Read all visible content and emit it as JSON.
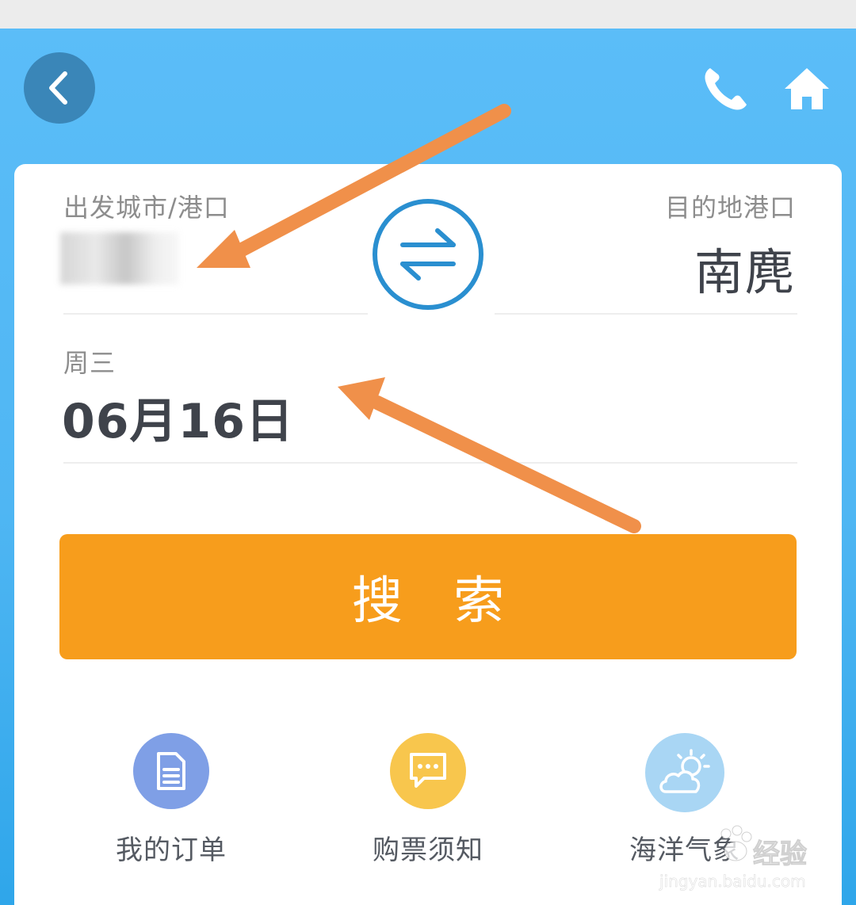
{
  "header": {
    "back_icon": "chevron-left-icon",
    "phone_icon": "phone-icon",
    "home_icon": "home-icon"
  },
  "route": {
    "from_label": "出发城市/港口",
    "from_value_obscured": true,
    "to_label": "目的地港口",
    "to_value": "南麂",
    "swap_icon": "swap-arrows-icon"
  },
  "date": {
    "weekday": "周三",
    "value": "06月16日"
  },
  "search": {
    "label": "搜 索"
  },
  "quick_links": [
    {
      "label": "我的订单",
      "icon": "document-icon"
    },
    {
      "label": "购票须知",
      "icon": "chat-bubble-icon"
    },
    {
      "label": "海洋气象",
      "icon": "weather-icon"
    }
  ],
  "watermark": {
    "text": "经验",
    "url": "jingyan.baidu.com"
  },
  "colors": {
    "header_bg": "#5bbdf8",
    "back_button": "#3a86b8",
    "search_button": "#f79d1c",
    "annotation_arrow": "#f0904a",
    "swap_icon": "#2a8fd0",
    "orders_icon_bg": "#7f9fe6",
    "notice_icon_bg": "#f8c64d",
    "weather_icon_bg": "#a9d6f4"
  }
}
